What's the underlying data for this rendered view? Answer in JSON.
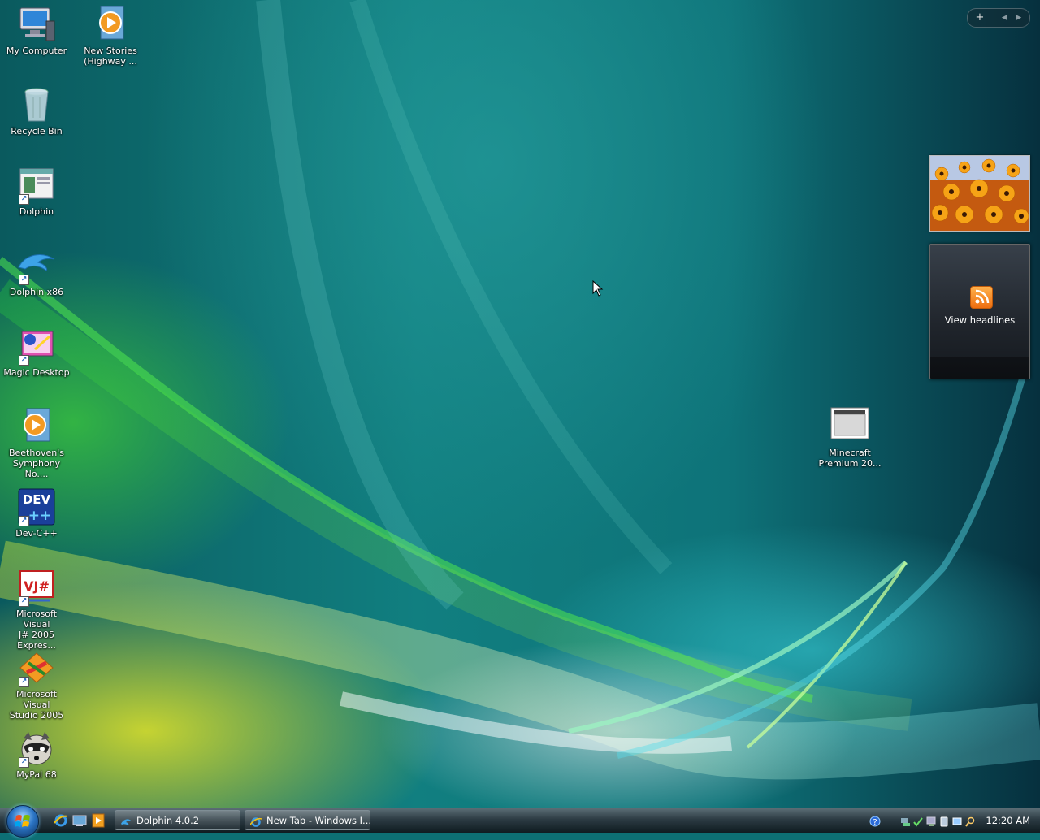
{
  "desktop_icons": [
    {
      "label_line1": "My Computer",
      "label_line2": "",
      "icon": "my-computer-icon"
    },
    {
      "label_line1": "New Stories",
      "label_line2": "(Highway ...",
      "icon": "media-file-icon"
    },
    {
      "label_line1": "Recycle Bin",
      "label_line2": "",
      "icon": "recycle-bin-icon"
    },
    {
      "label_line1": "Dolphin",
      "label_line2": "",
      "icon": "dolphin-app-icon"
    },
    {
      "label_line1": "Dolphin x86",
      "label_line2": "",
      "icon": "dolphin-logo-icon"
    },
    {
      "label_line1": "Magic Desktop",
      "label_line2": "",
      "icon": "magic-desktop-icon"
    },
    {
      "label_line1": "Beethoven's",
      "label_line2": "Symphony No....",
      "icon": "media-file-icon"
    },
    {
      "label_line1": "Dev-C++",
      "label_line2": "",
      "icon": "dev-cpp-icon"
    },
    {
      "label_line1": "Microsoft Visual",
      "label_line2": "J# 2005 Expres...",
      "icon": "visual-jsharp-icon"
    },
    {
      "label_line1": "Microsoft Visual",
      "label_line2": "Studio 2005",
      "icon": "visual-studio-icon"
    },
    {
      "label_line1": "MyPal 68",
      "label_line2": "",
      "icon": "mypal-raccoon-icon"
    },
    {
      "label_line1": "Minecraft",
      "label_line2": "Premium 20...",
      "icon": "window-file-icon"
    }
  ],
  "gadgets": {
    "controls": {
      "add": "+",
      "prev": "◂",
      "next": "▸"
    },
    "feeds": {
      "text": "View headlines"
    }
  },
  "taskbar": {
    "tasks": [
      {
        "label": "Dolphin 4.0.2"
      },
      {
        "label": "New Tab - Windows I..."
      }
    ],
    "clock": "12:20 AM"
  },
  "colors": {
    "taskbar_top": "#5b6d75",
    "taskbar_bottom": "#0f1b21",
    "desktop_teal": "#117f80"
  }
}
